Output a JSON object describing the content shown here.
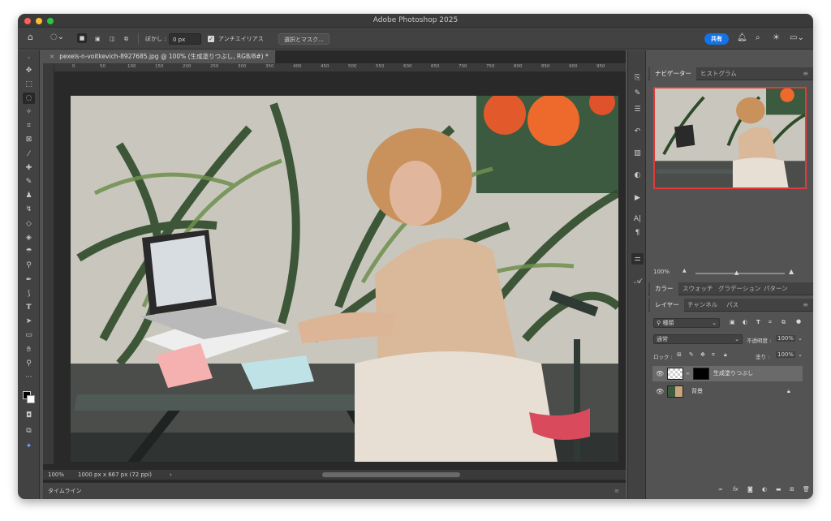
{
  "app": {
    "title": "Adobe Photoshop 2025"
  },
  "options": {
    "feather_label": "ぼかし :",
    "feather_value": "0 px",
    "antialias_label": "アンチエイリアス",
    "select_mask_label": "選択とマスク...",
    "share_label": "共有"
  },
  "document": {
    "tab_title": "pexels-n-voitkevich-8927685.jpg @ 100% (生成塗りつぶし, RGB/8#) *",
    "ruler_ticks": [
      "0",
      "50",
      "100",
      "150",
      "200",
      "250",
      "300",
      "350",
      "400",
      "450",
      "500",
      "550",
      "600",
      "650",
      "700",
      "750",
      "800",
      "850",
      "900",
      "950"
    ],
    "zoom": "100%",
    "info": "1000 px x 667 px (72 ppi)",
    "info_arrow": "›"
  },
  "timeline": {
    "label": "タイムライン"
  },
  "navigator": {
    "tabs": [
      "ナビゲーター",
      "ヒストグラム"
    ],
    "zoom": "100%"
  },
  "color_panel": {
    "tabs": [
      "カラー",
      "スウォッチ",
      "グラデーション",
      "パターン"
    ]
  },
  "layers": {
    "tabs": [
      "レイヤー",
      "チャンネル",
      "パス"
    ],
    "filter_label": "種類",
    "blend_mode": "通常",
    "opacity_label": "不透明度 :",
    "opacity_value": "100%",
    "lock_label": "ロック :",
    "fill_label": "塗り :",
    "fill_value": "100%",
    "items": [
      {
        "name": "生成塗りつぶし",
        "visible": true,
        "selected": true
      },
      {
        "name": "背景",
        "visible": true,
        "locked": true
      }
    ]
  },
  "colors": {
    "accent": "#1473e6",
    "panel_bg": "#535353",
    "dark_bg": "#424242",
    "canvas_bg": "#292929"
  }
}
